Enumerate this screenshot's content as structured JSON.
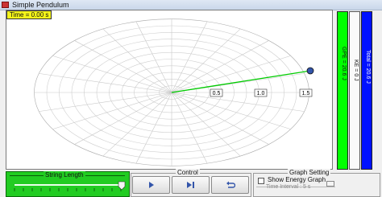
{
  "window": {
    "title": "Simple Pendulum",
    "icon": "java-app-icon"
  },
  "time": {
    "label": "Time = 0.00 s"
  },
  "scale_labels": [
    "0.5",
    "1.0",
    "1.5"
  ],
  "energy_bars": {
    "gpe": "GPE = 20.6 J",
    "ke": "KE = 0 J",
    "total": "Total = 20.6 J",
    "colors": {
      "gpe": "#00ff00",
      "ke": "#ffffff",
      "total": "#0011ff"
    }
  },
  "string_length": {
    "title": "String Length",
    "value_fraction": 1.0
  },
  "control": {
    "title": "Control",
    "buttons": [
      {
        "name": "play",
        "icon": "play-icon"
      },
      {
        "name": "step",
        "icon": "step-forward-icon"
      },
      {
        "name": "reset",
        "icon": "reset-icon"
      }
    ]
  },
  "graph_setting": {
    "title": "Graph Setting",
    "checkbox_label": "Show Energy Graph",
    "checked": false,
    "interval_label": "Time Interval : 5 s"
  }
}
